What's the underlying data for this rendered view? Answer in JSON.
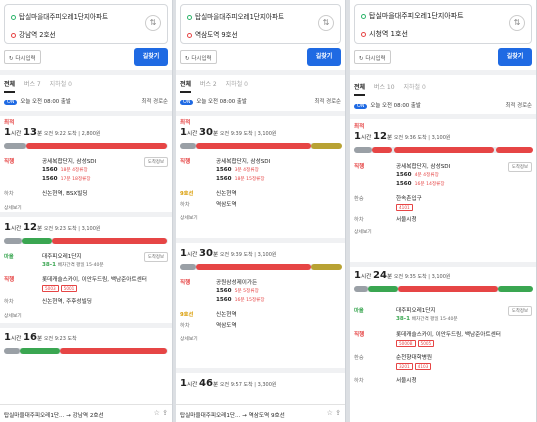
{
  "p1": {
    "origin": "탑실마을대주피오레1단지아파트",
    "dest": "강남역 2호선",
    "reset": "다시입력",
    "go": "길찾기",
    "tabs": [
      "전체",
      "버스 7",
      "지하철 0"
    ],
    "depart": "오늘 오전 08:00 출발",
    "sort": "최적 경로순",
    "r1": {
      "rank": "최적",
      "hours": "1",
      "mins": "13",
      "meta": "오전 9:22 도착 | 2,800원",
      "walk": "6분",
      "bus": "57분",
      "tag1": "직행",
      "stop1": "공세복합단지, 삼성SDI",
      "b1": "1560",
      "b1t": "18분 4정류장",
      "b2": "1560",
      "b2t": "17분 18정류장",
      "tag2": "하차",
      "stop2": "신논현역, BSX빌딩",
      "detail": "상세보기"
    },
    "r2": {
      "hours": "1",
      "mins": "12",
      "meta": "오전 9:23 도착 | 3,100원",
      "tag1": "마을",
      "stop1": "대주피오레1단지",
      "b1": "38-1",
      "b1t": "배차간격 평일 15-40분",
      "tag2": "직행",
      "stop2": "롯데캐슬스카이, 이안두드림, 백남준아트센터",
      "p1": "5003",
      "p2": "5001",
      "tag3": "하차",
      "stop3": "신논현역, 주후성빌딩",
      "detail": "상세보기"
    },
    "r3": {
      "hours": "1",
      "mins": "16",
      "meta": "오전 9:23 도착"
    },
    "bottom": "탑실마을대주피오레1단... → 강남역 2호선"
  },
  "p2": {
    "origin": "탑실마을대주피오레1단지아파트",
    "dest": "역삼도역 9호선",
    "reset": "다시입력",
    "go": "길찾기",
    "tabs": [
      "전체",
      "버스 2",
      "지하철 0"
    ],
    "depart": "오늘 오전 08:00 출발",
    "sort": "최적 경로순",
    "r1": {
      "rank": "최적",
      "hours": "1",
      "mins": "30",
      "meta": "오전 9:39 도착 | 3,100원",
      "tag1": "직행",
      "stop1": "공세복합단지, 삼성SDI",
      "b1": "1560",
      "b1t": "3분 4정류장",
      "b2": "1560",
      "b2t": "18분 15정류장",
      "tag2": "9호선",
      "stop2": "신논현역",
      "tag3": "하차",
      "stop3": "역삼도역",
      "detail": "상세보기"
    },
    "r2": {
      "hours": "1",
      "mins": "30",
      "meta": "오전 9:39 도착 | 3,100원",
      "tag1": "직행",
      "stop1": "공원삼성제이가든",
      "b1": "1560",
      "b1t": "5분 5정류장",
      "b2": "1560",
      "b2t": "16분 15정류장",
      "tag2": "9호선",
      "stop2": "신논현역",
      "tag3": "하차",
      "stop3": "역삼도역",
      "detail": "상세보기"
    },
    "r3": {
      "hours": "1",
      "mins": "46",
      "meta": "오전 9:57 도착 | 3,300원"
    },
    "bottom": "탑실마을대주피오레1단... → 역삼도역 9호선"
  },
  "p3": {
    "origin": "탑실마을대주피오레1단지아파트",
    "dest": "시청역 1호선",
    "reset": "다시입력",
    "go": "길찾기",
    "tabs": [
      "전체",
      "버스 10",
      "지하철 0"
    ],
    "depart": "오늘 오전 08:00 출발",
    "sort": "최적 경로순",
    "r1": {
      "rank": "최적",
      "hours": "1",
      "mins": "12",
      "meta": "오전 9:36 도착 | 3,100원",
      "tag1": "직행",
      "stop1": "공세복합단지, 삼성SDI",
      "b1": "1560",
      "b1t": "4분 4정류장",
      "b2": "1560",
      "b2t": "16분 14정류장",
      "tag2": "환승",
      "stop2": "한속촌입구",
      "p1": "4101",
      "tag3": "하차",
      "stop3": "서울시청",
      "detail": "상세보기"
    },
    "r2": {
      "hours": "1",
      "mins": "24",
      "meta": "오전 9:35 도착 | 3,100원",
      "tag1": "마을",
      "stop1": "대주피오레1단지",
      "b1": "38-1",
      "b1t": "배차간격 평일 15-40분",
      "tag2": "직행",
      "stop2": "롯데캐슬스카이, 이안두드림, 백남준아트센터",
      "p1": "5000B",
      "p2": "5005",
      "tag3": "환승",
      "stop3": "순천향대학병원",
      "p3": "3201",
      "p4": "4103",
      "tag4": "하차",
      "stop4": "서울시청"
    }
  }
}
